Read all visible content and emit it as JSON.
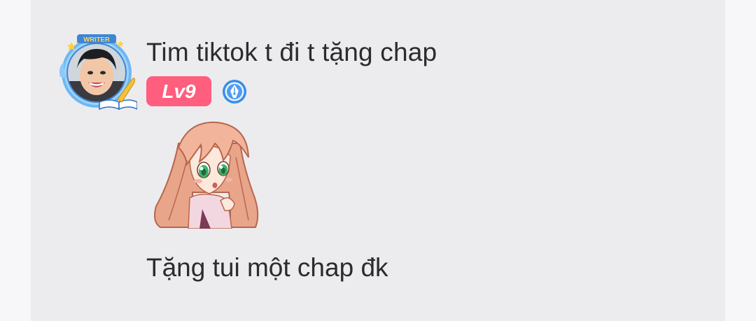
{
  "comment": {
    "username": "Tim tiktok t đi t tặng chap",
    "level": "Lv9",
    "avatar_frame_label": "WRITER",
    "text": "Tặng tui một chap đk"
  },
  "icons": {
    "avatar": "user-avatar-with-writer-frame",
    "author_badge": "pen-nib-badge-icon",
    "sticker": "anime-girl-sticker"
  },
  "colors": {
    "card_background": "#ececef",
    "level_badge": "#ff5e7e",
    "author_badge": "#3a8ee6",
    "text": "#2c2c2e"
  }
}
